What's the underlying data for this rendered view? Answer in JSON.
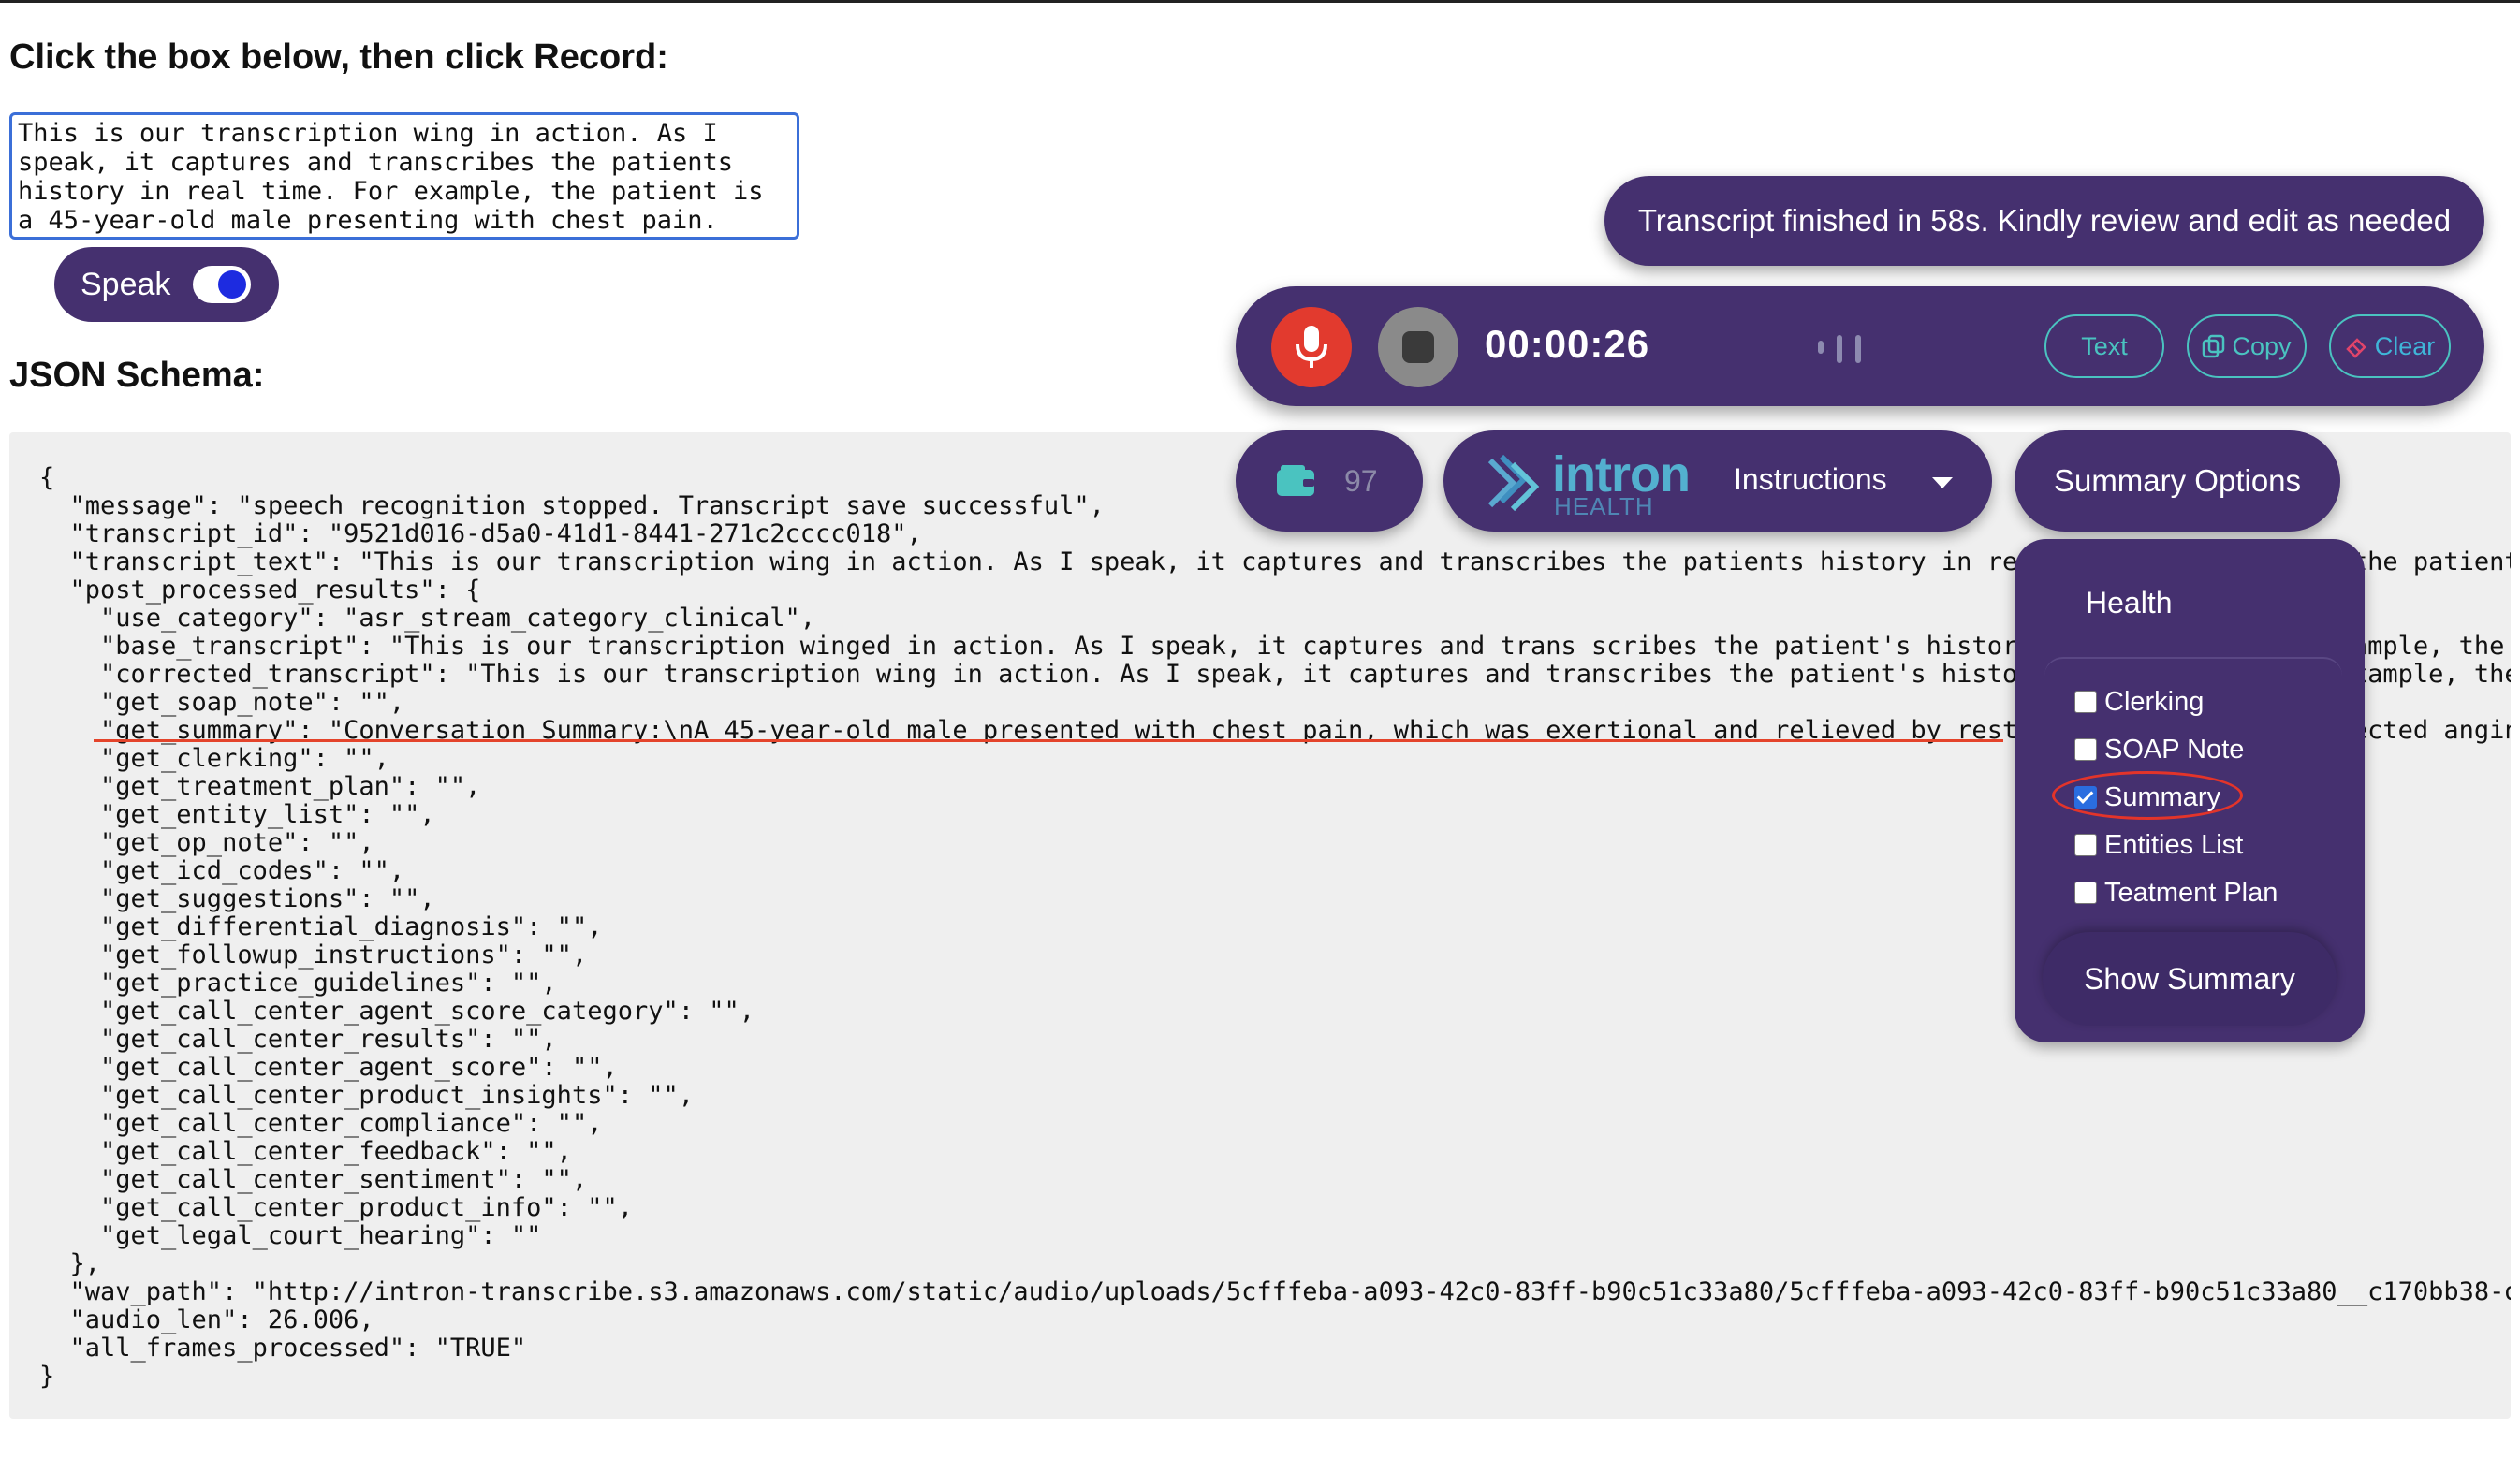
{
  "page": {
    "prompt_heading": "Click the box below, then click Record:",
    "schema_heading": "JSON Schema:"
  },
  "textarea": {
    "value": "This is our transcription wing in action. As I speak, it captures and transcribes the patients history in real time. For example, the patient is a 45-year-old male presenting with chest pain."
  },
  "speak_toggle": {
    "label": "Speak",
    "on": true
  },
  "json_text": "{\n  \"message\": \"speech recognition stopped. Transcript save successful\",\n  \"transcript_id\": \"9521d016-d5a0-41d1-8441-271c2cccc018\",\n  \"transcript_text\": \"This is our transcription wing in action. As I speak, it captures and transcribes the patients history in real time. For example, the patient is a 45-year-old male presenting with chest pain.\",\n  \"post_processed_results\": {\n    \"use_category\": \"asr_stream_category_clinical\",\n    \"base_transcript\": \"This is our transcription winged in action. As I speak, it captures and trans scribes the patient's history in real time. For example, the patient is\n    \"corrected_transcript\": \"This is our transcription wing in action. As I speak, it captures and transcribes the patient's history in real time. For example, the patie\n    \"get_soap_note\": \"\",\n    \"get_summary\": \"Conversation Summary:\\nA 45-year-old male presented with chest pain, which was exertional and relieved by rest. The patient was suspected angin\n    \"get_clerking\": \"\",\n    \"get_treatment_plan\": \"\",\n    \"get_entity_list\": \"\",\n    \"get_op_note\": \"\",\n    \"get_icd_codes\": \"\",\n    \"get_suggestions\": \"\",\n    \"get_differential_diagnosis\": \"\",\n    \"get_followup_instructions\": \"\",\n    \"get_practice_guidelines\": \"\",\n    \"get_call_center_agent_score_category\": \"\",\n    \"get_call_center_results\": \"\",\n    \"get_call_center_agent_score\": \"\",\n    \"get_call_center_product_insights\": \"\",\n    \"get_call_center_compliance\": \"\",\n    \"get_call_center_feedback\": \"\",\n    \"get_call_center_sentiment\": \"\",\n    \"get_call_center_product_info\": \"\",\n    \"get_legal_court_hearing\": \"\"\n  },\n  \"wav_path\": \"http://intron-transcribe.s3.amazonaws.com/static/audio/uploads/5cfffeba-a093-42c0-83ff-b90c51c33a80/5cfffeba-a093-42c0-83ff-b90c51c33a80__c170bb38-dd5a-46\n  \"audio_len\": 26.006,\n  \"all_frames_processed\": \"TRUE\"\n}",
  "toast": {
    "message": "Transcript finished in 58s. Kindly review and edit as needed"
  },
  "recorder": {
    "timer": "00:00:26",
    "text_label": "Text",
    "copy_label": "Copy",
    "clear_label": "Clear",
    "mic_icon": "microphone-icon",
    "stop_icon": "stop-icon"
  },
  "credits": {
    "count": "97",
    "icon": "wallet-icon"
  },
  "brand": {
    "name": "intron",
    "sub": "HEALTH"
  },
  "instructions": {
    "label": "Instructions"
  },
  "summary_options": {
    "button_label": "Summary Options",
    "category": "Health",
    "options": [
      {
        "label": "Clerking",
        "checked": false
      },
      {
        "label": "SOAP Note",
        "checked": false
      },
      {
        "label": "Summary",
        "checked": true
      },
      {
        "label": "Entities List",
        "checked": false
      },
      {
        "label": "Teatment Plan",
        "checked": false
      }
    ],
    "show_button_label": "Show Summary"
  },
  "colors": {
    "panel_purple": "#45306f",
    "accent_teal": "#4ac3c0",
    "record_red": "#e23a2e",
    "annotation_red": "#e4442b"
  }
}
